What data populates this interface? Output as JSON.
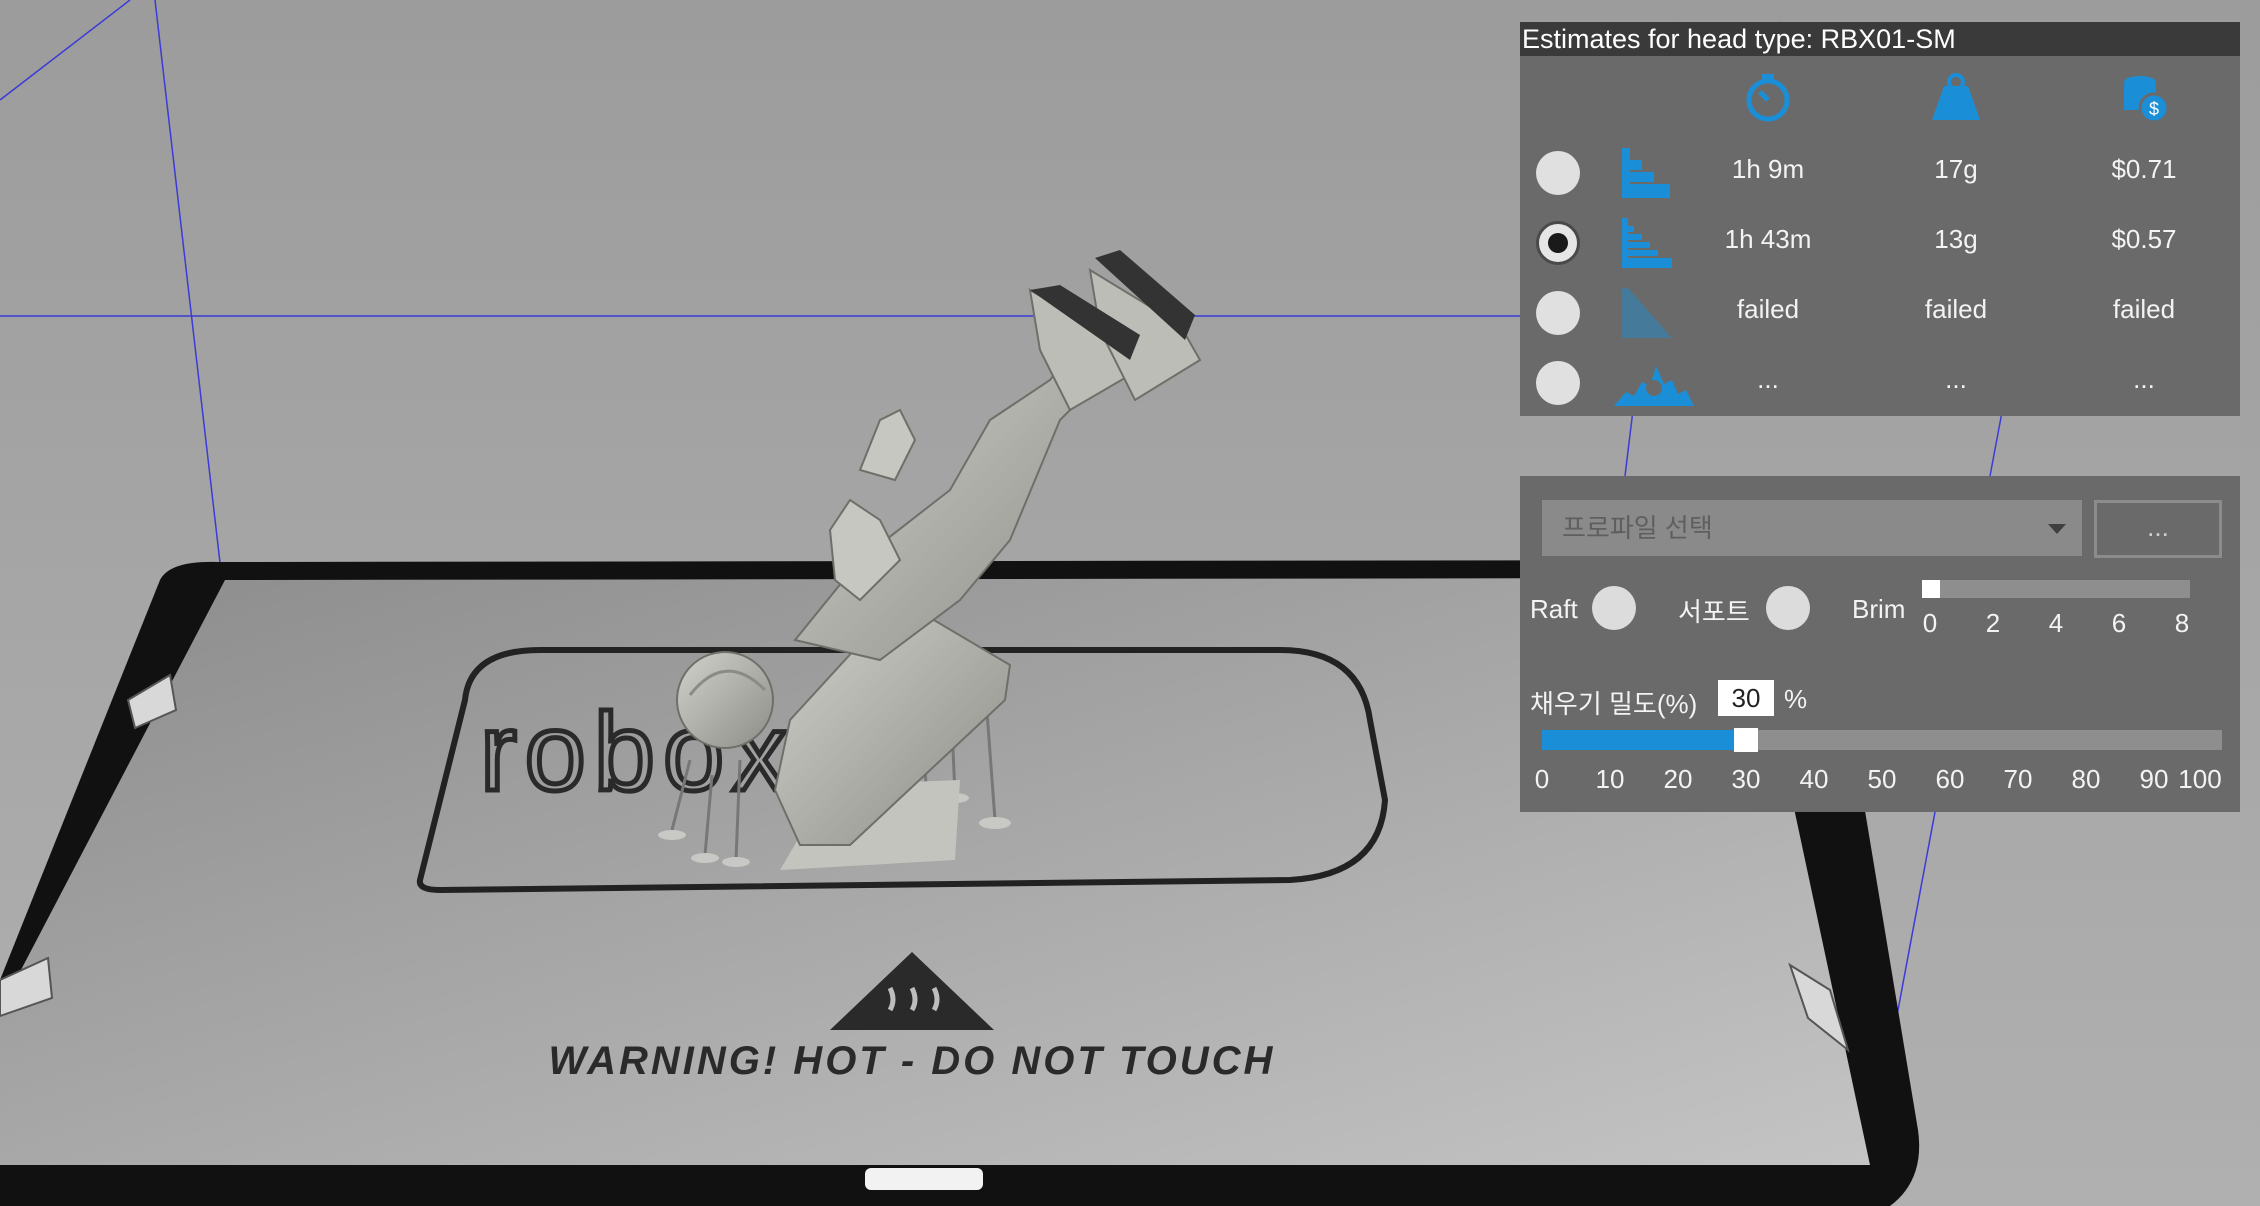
{
  "viewport": {
    "bed_warning": "WARNING! HOT - DO NOT TOUCH",
    "bed_logo": "robox"
  },
  "estimates": {
    "title": "Estimates for head type: RBX01-SM",
    "header_icons": [
      "timer-icon",
      "weight-icon",
      "cost-icon"
    ],
    "rows": [
      {
        "quality_icon": "quality-draft-icon",
        "selected": false,
        "time": "1h 9m",
        "weight": "17g",
        "cost": "$0.71"
      },
      {
        "quality_icon": "quality-normal-icon",
        "selected": true,
        "time": "1h 43m",
        "weight": "13g",
        "cost": "$0.57"
      },
      {
        "quality_icon": "quality-fine-icon",
        "selected": false,
        "time": "failed",
        "weight": "failed",
        "cost": "failed"
      },
      {
        "quality_icon": "quality-custom-icon",
        "selected": false,
        "time": "...",
        "weight": "...",
        "cost": "..."
      }
    ],
    "accent_color": "#1a8fd8"
  },
  "settings": {
    "profile_placeholder": "프로파일 선택",
    "more_label": "...",
    "raft_label": "Raft",
    "support_label": "서포트",
    "brim_label": "Brim",
    "brim_value": 0,
    "brim_ticks": [
      "0",
      "2",
      "4",
      "6",
      "8"
    ],
    "infill_label": "채우기 밀도(%)",
    "infill_value": "30",
    "infill_unit": "%",
    "infill_fraction": 0.3,
    "infill_ticks": [
      "0",
      "10",
      "20",
      "30",
      "40",
      "50",
      "60",
      "70",
      "80",
      "90",
      "100"
    ]
  }
}
